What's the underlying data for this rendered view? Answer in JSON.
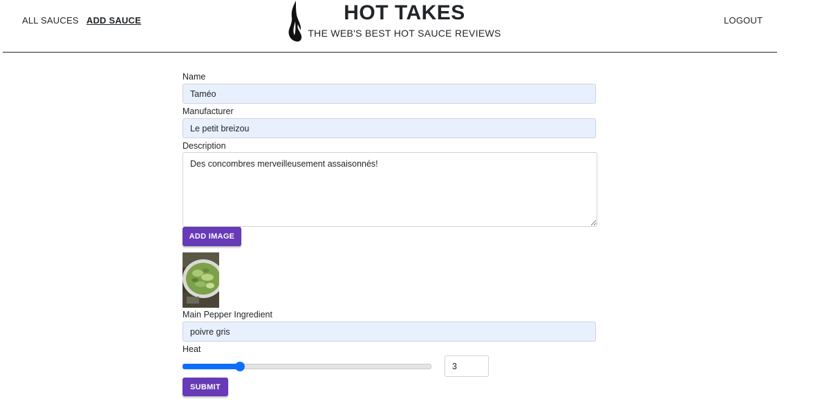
{
  "nav": {
    "all_sauces": "ALL SAUCES",
    "add_sauce": "ADD SAUCE",
    "logout": "LOGOUT"
  },
  "brand": {
    "title": "HOT TAKES",
    "tagline": "THE WEB'S BEST HOT SAUCE REVIEWS",
    "logo_icon": "flame-icon"
  },
  "form": {
    "name_label": "Name",
    "name_value": "Taméo",
    "manufacturer_label": "Manufacturer",
    "manufacturer_value": "Le petit breizou",
    "description_label": "Description",
    "description_value": "Des concombres merveilleusement assaisonnés!",
    "add_image_label": "ADD IMAGE",
    "pepper_label": "Main Pepper Ingredient",
    "pepper_value": "poivre gris",
    "heat_label": "Heat",
    "heat_value": "3",
    "heat_min": 1,
    "heat_max": 10,
    "submit_label": "SUBMIT"
  },
  "colors": {
    "accent": "#673ab7",
    "slider": "#0d6efd",
    "autofill_bg": "#e8f0fe"
  }
}
